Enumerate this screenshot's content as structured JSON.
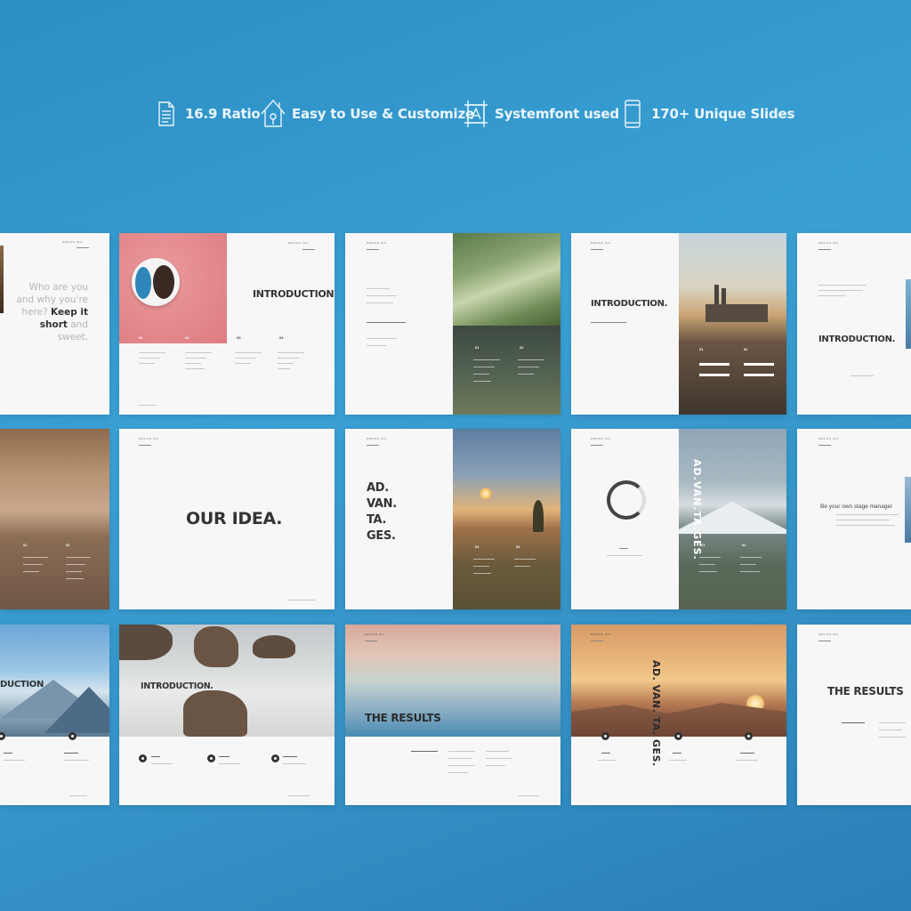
{
  "features": [
    {
      "icon": "document-icon",
      "label": "16.9 Ratio"
    },
    {
      "icon": "house-icon",
      "label": "Easy to Use & Customize"
    },
    {
      "icon": "font-icon",
      "label": "Systemfont used"
    },
    {
      "icon": "phone-icon",
      "label": "170+ Unique Slides"
    }
  ],
  "slides": {
    "s1_text_a": "Who are you",
    "s1_text_b": "and why you're",
    "s1_text_c": "here?",
    "s1_text_d": "Keep it",
    "s1_text_e": "short",
    "s1_text_f": "and",
    "s1_text_g": "sweet.",
    "s2_title": "INTRODUCTION.",
    "s4_title": "INTRODUCTION.",
    "s5_title": "INTRODUCTION.",
    "s7_title": "OUR IDEA.",
    "s8_title_1": "AD.",
    "s8_title_2": "VAN.",
    "s8_title_3": "TA.",
    "s8_title_4": "GES.",
    "s9_title": "AD.VAN.TA.GES.",
    "s10_subtitle": "Be your own stage manager",
    "s11_title": "DUCTION",
    "s12_title": "INTRODUCTION.",
    "s13_title": "THE RESULTS",
    "s14_title": "AD. VAN. TA. GES.",
    "s15_title": "THE RESULTS"
  },
  "colors": {
    "background": "#3aa0d4",
    "slide": "#f7f7f7",
    "pink": "#e38a8e",
    "title_text": "#333333"
  }
}
